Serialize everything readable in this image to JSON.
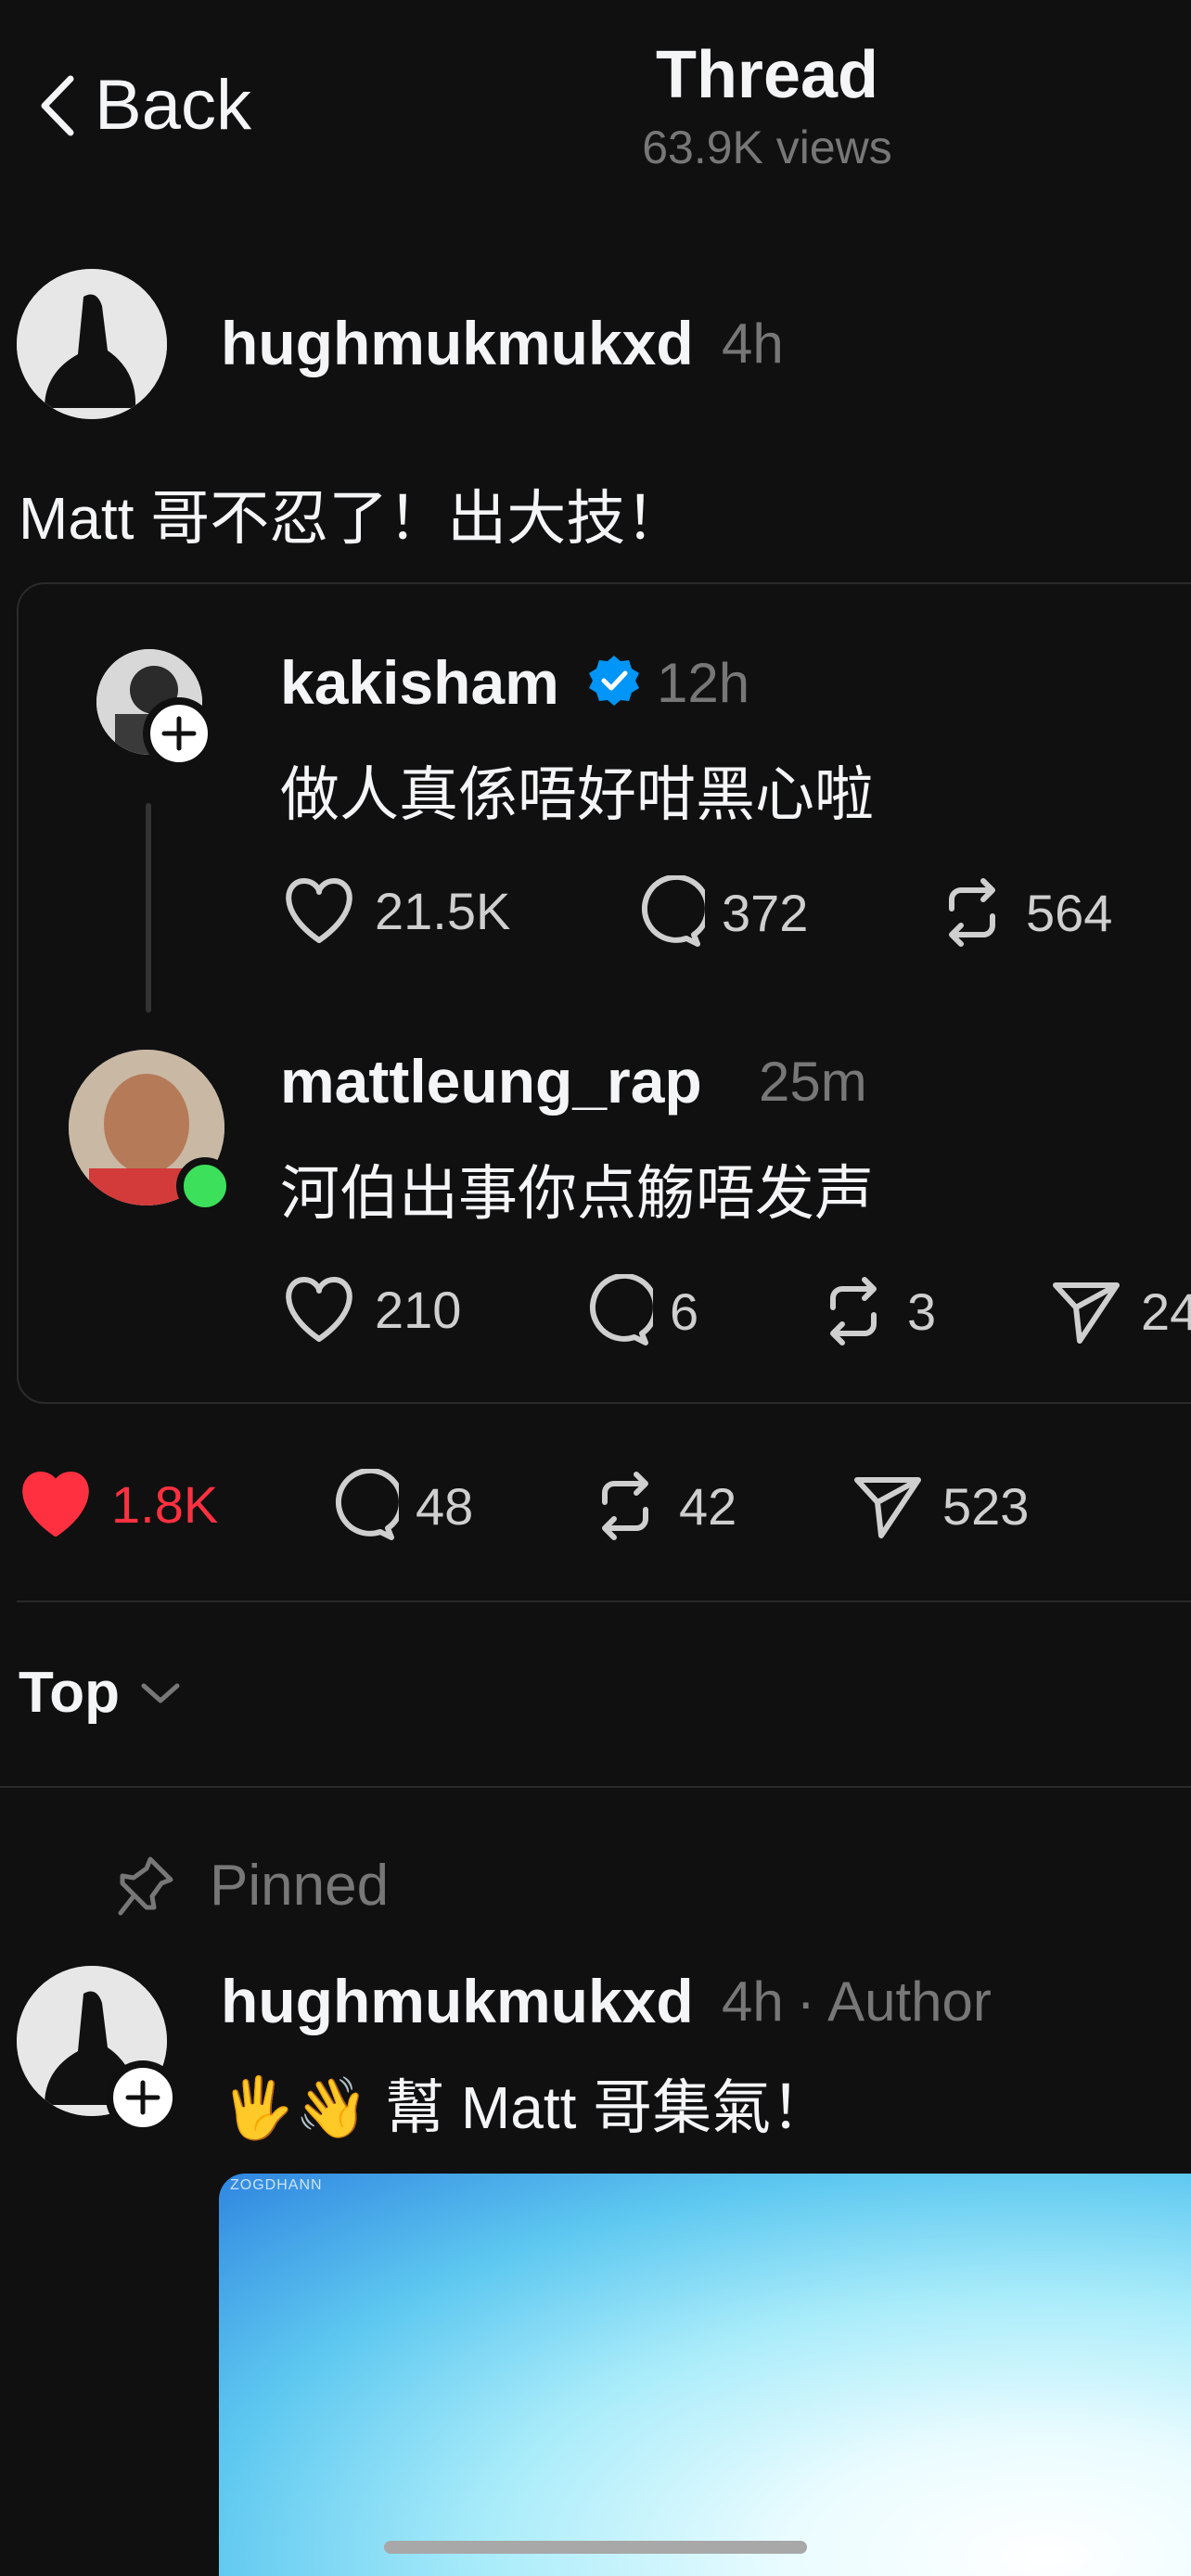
{
  "header": {
    "back_label": "Back",
    "title": "Thread",
    "views": "63.9K views"
  },
  "post": {
    "username": "hughmukmukxd",
    "time": "4h",
    "text": "Matt 哥不忍了！出大技！",
    "quote": {
      "first": {
        "username": "kakisham",
        "time": "12h",
        "text": "做人真係唔好咁黑心啦",
        "likes": "21.5K",
        "replies": "372",
        "reposts": "564"
      },
      "second": {
        "username": "mattleung_rap",
        "time": "25m",
        "text": "河伯出事你点觞唔发声",
        "likes": "210",
        "replies": "6",
        "reposts": "3",
        "shares": "24"
      }
    },
    "actions": {
      "likes": "1.8K",
      "replies": "48",
      "reposts": "42",
      "shares": "523"
    }
  },
  "sort": {
    "label": "Top"
  },
  "reply": {
    "pinned_label": "Pinned",
    "username": "hughmukmukxd",
    "time": "4h",
    "role": "· Author",
    "text": "🖐️👋 幫 Matt 哥集氣！",
    "media_watermark": "ZOGDHANN"
  },
  "colors": {
    "background": "#101010",
    "like_red": "#ff3040",
    "verified_blue": "#0095f6",
    "online_green": "#3ce05b"
  }
}
